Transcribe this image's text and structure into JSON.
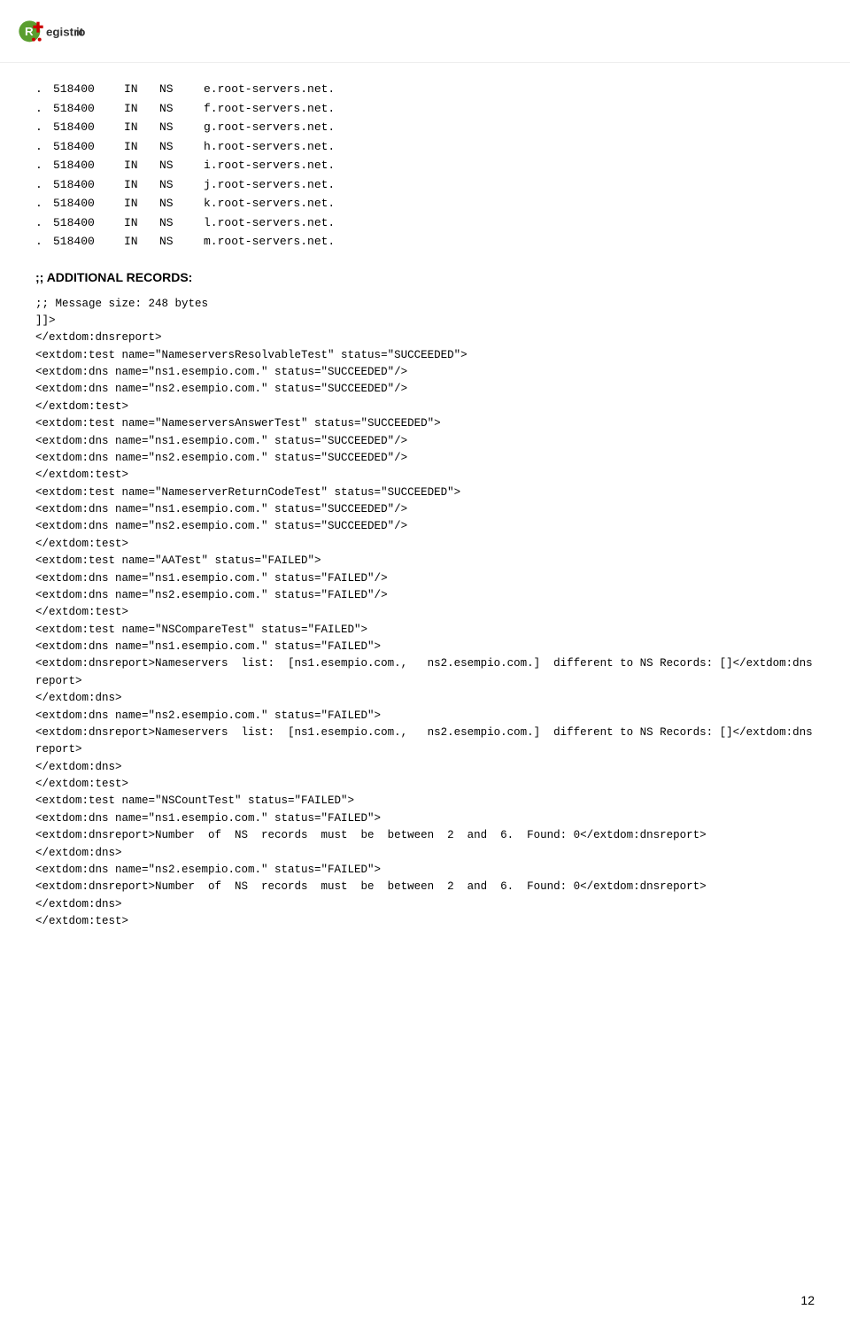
{
  "logo": {
    "text": "Registro",
    "suffix": "it"
  },
  "dns_records": [
    {
      "dot": ".",
      "ttl": "518400",
      "class": "IN",
      "type": "NS",
      "value": "e.root-servers.net."
    },
    {
      "dot": ".",
      "ttl": "518400",
      "class": "IN",
      "type": "NS",
      "value": "f.root-servers.net."
    },
    {
      "dot": ".",
      "ttl": "518400",
      "class": "IN",
      "type": "NS",
      "value": "g.root-servers.net."
    },
    {
      "dot": ".",
      "ttl": "518400",
      "class": "IN",
      "type": "NS",
      "value": "h.root-servers.net."
    },
    {
      "dot": ".",
      "ttl": "518400",
      "class": "IN",
      "type": "NS",
      "value": "i.root-servers.net."
    },
    {
      "dot": ".",
      "ttl": "518400",
      "class": "IN",
      "type": "NS",
      "value": "j.root-servers.net."
    },
    {
      "dot": ".",
      "ttl": "518400",
      "class": "IN",
      "type": "NS",
      "value": "k.root-servers.net."
    },
    {
      "dot": ".",
      "ttl": "518400",
      "class": "IN",
      "type": "NS",
      "value": "l.root-servers.net."
    },
    {
      "dot": ".",
      "ttl": "518400",
      "class": "IN",
      "type": "NS",
      "value": "m.root-servers.net."
    }
  ],
  "section_header": ";; ADDITIONAL RECORDS:",
  "xml_block": ";; Message size: 248 bytes\n]]>\n</extdom:dnsreport>\n<extdom:test name=\"NameserversResolvableTest\" status=\"SUCCEEDED\">\n<extdom:dns name=\"ns1.esempio.com.\" status=\"SUCCEEDED\"/>\n<extdom:dns name=\"ns2.esempio.com.\" status=\"SUCCEEDED\"/>\n</extdom:test>\n<extdom:test name=\"NameserversAnswerTest\" status=\"SUCCEEDED\">\n<extdom:dns name=\"ns1.esempio.com.\" status=\"SUCCEEDED\"/>\n<extdom:dns name=\"ns2.esempio.com.\" status=\"SUCCEEDED\"/>\n</extdom:test>\n<extdom:test name=\"NameserverReturnCodeTest\" status=\"SUCCEEDED\">\n<extdom:dns name=\"ns1.esempio.com.\" status=\"SUCCEEDED\"/>\n<extdom:dns name=\"ns2.esempio.com.\" status=\"SUCCEEDED\"/>\n</extdom:test>\n<extdom:test name=\"AATest\" status=\"FAILED\">\n<extdom:dns name=\"ns1.esempio.com.\" status=\"FAILED\"/>\n<extdom:dns name=\"ns2.esempio.com.\" status=\"FAILED\"/>\n</extdom:test>\n<extdom:test name=\"NSCompareTest\" status=\"FAILED\">\n<extdom:dns name=\"ns1.esempio.com.\" status=\"FAILED\">\n<extdom:dnsreport>Nameservers  list:  [ns1.esempio.com.,   ns2.esempio.com.]  different to NS Records: []</extdom:dnsreport>\n</extdom:dns>\n<extdom:dns name=\"ns2.esempio.com.\" status=\"FAILED\">\n<extdom:dnsreport>Nameservers  list:  [ns1.esempio.com.,   ns2.esempio.com.]  different to NS Records: []</extdom:dnsreport>\n</extdom:dns>\n</extdom:test>\n<extdom:test name=\"NSCountTest\" status=\"FAILED\">\n<extdom:dns name=\"ns1.esempio.com.\" status=\"FAILED\">\n<extdom:dnsreport>Number  of  NS  records  must  be  between  2  and  6.  Found: 0</extdom:dnsreport>\n</extdom:dns>\n<extdom:dns name=\"ns2.esempio.com.\" status=\"FAILED\">\n<extdom:dnsreport>Number  of  NS  records  must  be  between  2  and  6.  Found: 0</extdom:dnsreport>\n</extdom:dns>\n</extdom:test>",
  "page_number": "12"
}
